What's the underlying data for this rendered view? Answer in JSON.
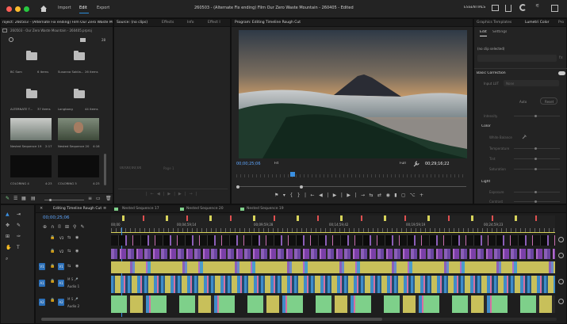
{
  "colors": {
    "accent": "#2b8cd9",
    "timecode": "#5fa7ff",
    "playhead": "#3a8fe0",
    "video_clip": "#8b5fb8",
    "yellow_clip": "#c8c05a",
    "pink_clip": "#d86fa0",
    "green_clip": "#7ed08a"
  },
  "menu": {
    "home_icon": "home-icon",
    "import": "Import",
    "edit": "Edit",
    "export": "Export"
  },
  "window_title": "260503 - (Alternate Fix ending) Film Our Zero Waste Mountain - 260405 - Edited",
  "workspace": {
    "label": "ESSENTIALS"
  },
  "project": {
    "tab_label": "roject: 260503 - (Alternate Fix ending) Film Our Zero Waste M",
    "path": "260503 - Our Zero Waste Mountain - 260405.prproj",
    "item_count": "28",
    "bins": [
      {
        "name": "BC Sam",
        "count": "6 items"
      },
      {
        "name": "Susanna Sakila...",
        "count": "26 items"
      },
      {
        "name": "ALTERNATE T...",
        "count": "37 items"
      },
      {
        "name": "Longbong",
        "count": "44 items"
      }
    ],
    "clips": [
      {
        "name": "Nested Sequence 19",
        "duration": "2:17"
      },
      {
        "name": "Nested Sequence 20",
        "duration": "4:16"
      },
      {
        "name": "COLORING 4",
        "duration": "4:23"
      },
      {
        "name": "COLORING 5",
        "duration": "4:23"
      }
    ]
  },
  "source": {
    "tabs": [
      "Source: (no clips)",
      "Effects",
      "Info",
      "Effect I"
    ],
    "timecode": "00;00;00;00",
    "page": "Page 1"
  },
  "program": {
    "tab": "Program: Editing Timeline Rough Cut",
    "timecode_in": "00;00;25;06",
    "fit": "Fit",
    "quality": "Full",
    "timecode_dur": "00;29;16;22"
  },
  "right_panel": {
    "tabs": [
      "Graphics Templates",
      "Lumetri Color",
      "Pro"
    ],
    "subtabs": [
      "Edit",
      "Settings"
    ],
    "no_clip": "(no clip selected)",
    "basic_correction": "Basic Correction",
    "input_lut": "Input LUT",
    "input_lut_value": "None",
    "auto": "Auto",
    "reset": "Reset",
    "intensity": "Intensity",
    "color_section": "Color",
    "white_balance": "White Balance",
    "temperature": "Temperature",
    "tint": "Tint",
    "saturation": "Saturation",
    "light_section": "Light",
    "exposure": "Exposure",
    "contrast": "Contrast"
  },
  "timeline": {
    "tabs": [
      "Editing Timeline Rough Cut",
      "Nested Sequence 17",
      "Nested Sequence 20",
      "Nested Sequence 19"
    ],
    "timecode": "00;00;25;06",
    "ruler": [
      "00;00",
      "00;04;59;14",
      "00;09;59;28",
      "00;14;59;42",
      "00;19;59;19",
      "00;24;59;23"
    ],
    "tracks": [
      {
        "id": "V3",
        "name": ""
      },
      {
        "id": "V2",
        "name": ""
      },
      {
        "id": "V1",
        "name": ""
      },
      {
        "id": "A1",
        "name": "Audio 1"
      },
      {
        "id": "A2",
        "name": "Audio 2"
      }
    ]
  }
}
